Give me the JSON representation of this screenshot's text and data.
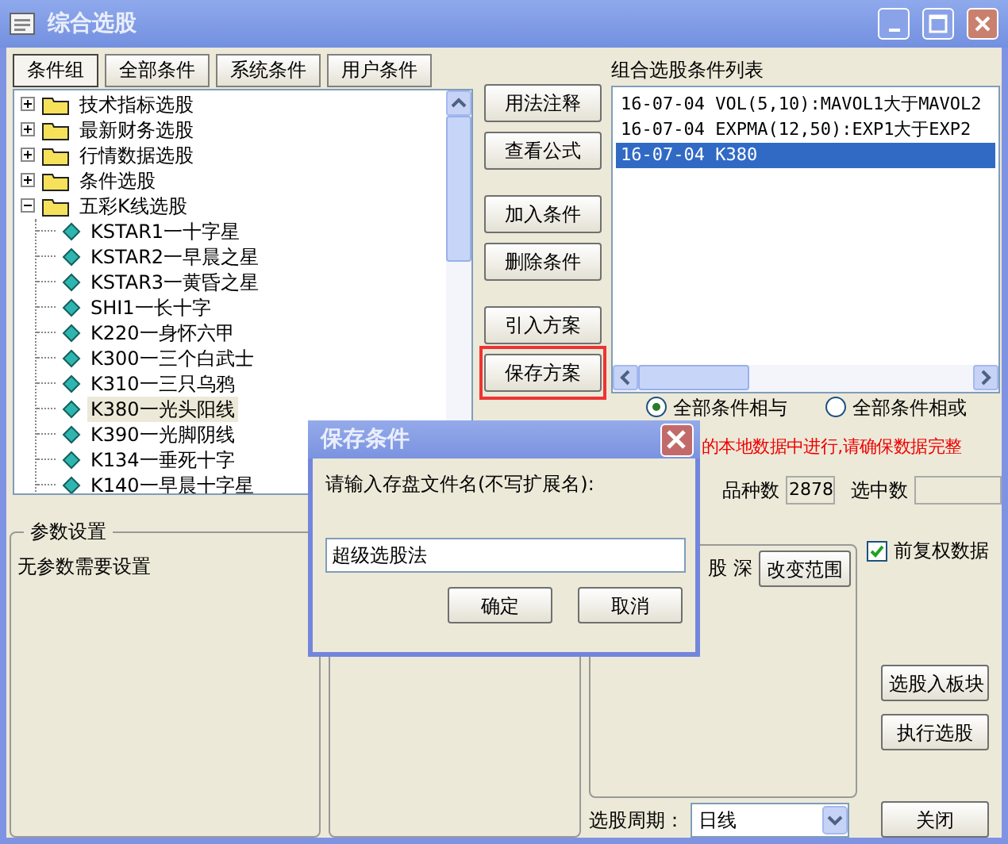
{
  "window": {
    "title": "综合选股"
  },
  "tabs": [
    {
      "label": "条件组",
      "selected": true
    },
    {
      "label": "全部条件",
      "selected": false
    },
    {
      "label": "系统条件",
      "selected": false
    },
    {
      "label": "用户条件",
      "selected": false
    }
  ],
  "tree": [
    {
      "label": "技术指标选股",
      "expanded": false
    },
    {
      "label": "最新财务选股",
      "expanded": false
    },
    {
      "label": "行情数据选股",
      "expanded": false
    },
    {
      "label": "条件选股",
      "expanded": false
    },
    {
      "label": "五彩K线选股",
      "expanded": true,
      "children": [
        {
          "label": "KSTAR1一十字星",
          "selected": false
        },
        {
          "label": "KSTAR2一早晨之星",
          "selected": false
        },
        {
          "label": "KSTAR3一黄昏之星",
          "selected": false
        },
        {
          "label": "SHI1一长十字",
          "selected": false
        },
        {
          "label": "K220一身怀六甲",
          "selected": false
        },
        {
          "label": "K300一三个白武士",
          "selected": false
        },
        {
          "label": "K310一三只乌鸦",
          "selected": false
        },
        {
          "label": "K380一光头阳线",
          "selected": true
        },
        {
          "label": "K390一光脚阴线",
          "selected": false
        },
        {
          "label": "K134一垂死十字",
          "selected": false
        },
        {
          "label": "K140一早晨十字星",
          "selected": false
        }
      ]
    }
  ],
  "side_button_groups": [
    [
      {
        "label": "用法注释",
        "outlined": false
      },
      {
        "label": "查看公式",
        "outlined": false
      }
    ],
    [
      {
        "label": "加入条件",
        "outlined": false
      },
      {
        "label": "删除条件",
        "outlined": false
      }
    ],
    [
      {
        "label": "引入方案",
        "outlined": false
      },
      {
        "label": "保存方案",
        "outlined": true
      }
    ]
  ],
  "condition_list": {
    "title": "组合选股条件列表",
    "items": [
      {
        "text": "16-07-04 VOL(5,10):MAVOL1大于MAVOL2",
        "selected": false
      },
      {
        "text": "16-07-04 EXPMA(12,50):EXP1大于EXP2",
        "selected": false
      },
      {
        "text": "16-07-04 K380",
        "selected": true
      }
    ]
  },
  "logic": [
    {
      "label": "全部条件相与",
      "selected": true
    },
    {
      "label": "全部条件相或",
      "selected": false
    }
  ],
  "notice": "的本地数据中进行,请确保数据完整",
  "stats": {
    "count_label": "品种数",
    "count": "2878",
    "picked_label": "选中数"
  },
  "params": {
    "title": "参数设置",
    "text": "无参数需要设置"
  },
  "range": {
    "text": "股 深",
    "button": "改变范围"
  },
  "adjust": {
    "label": "前复权数据",
    "checked": true
  },
  "actions": [
    "选股入板块",
    "执行选股",
    "关闭"
  ],
  "period": {
    "label": "选股周期：",
    "value": "日线"
  },
  "dialog": {
    "title": "保存条件",
    "prompt": "请输入存盘文件名(不写扩展名):",
    "value": "超级选股法",
    "buttons": [
      "确定",
      "取消"
    ]
  }
}
